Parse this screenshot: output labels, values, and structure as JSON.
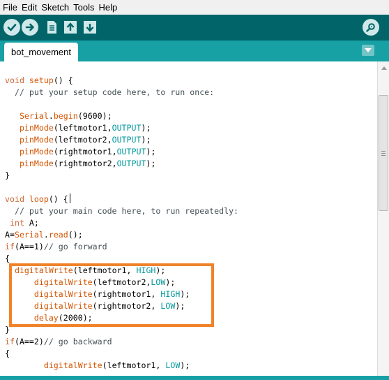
{
  "menu": {
    "items": [
      "File",
      "Edit",
      "Sketch",
      "Tools",
      "Help"
    ]
  },
  "toolbar": {
    "buttons": [
      {
        "name": "verify-button",
        "icon": "checkmark-icon"
      },
      {
        "name": "upload-button",
        "icon": "arrow-right-icon"
      },
      {
        "name": "new-button",
        "icon": "document-icon"
      },
      {
        "name": "open-button",
        "icon": "arrow-up-icon"
      },
      {
        "name": "save-button",
        "icon": "arrow-down-icon"
      },
      {
        "name": "serial-monitor-button",
        "icon": "magnifier-icon"
      }
    ]
  },
  "tabs": [
    {
      "label": "bot_movement",
      "active": true
    }
  ],
  "editor": {
    "lines": [
      "",
      "void setup() {",
      "  // put your setup code here, to run once:",
      "",
      "   Serial.begin(9600);",
      "   pinMode(leftmotor1,OUTPUT);",
      "   pinMode(leftmotor2,OUTPUT);",
      "   pinMode(rightmotor1,OUTPUT);",
      "   pinMode(rightmotor2,OUTPUT);",
      "}",
      "",
      "void loop() {",
      "  // put your main code here, to run repeatedly:",
      " int A;",
      "A=Serial.read();",
      "if(A==1)// go forward",
      "{",
      "  digitalWrite(leftmotor1, HIGH);",
      "      digitalWrite(leftmotor2,LOW);",
      "      digitalWrite(rightmotor1, HIGH);",
      "      digitalWrite(rightmotor2, LOW);",
      "      delay(2000);",
      "}",
      "if(A==2)// go backward",
      "{",
      "        digitalWrite(leftmotor1, LOW);"
    ]
  },
  "colors": {
    "toolbar": "#006468",
    "tabstrip": "#17a1a5",
    "highlight": "#f0832a",
    "keyword": "#cc6633",
    "type": "#00979c"
  }
}
